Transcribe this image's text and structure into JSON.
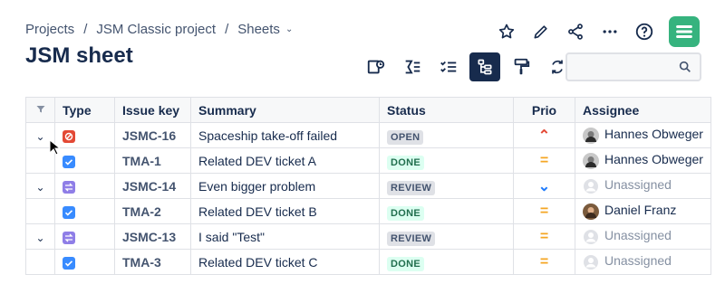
{
  "breadcrumb": {
    "items": [
      "Projects",
      "JSM Classic project",
      "Sheets"
    ],
    "sep": "/",
    "caret": "⌄"
  },
  "page": {
    "title": "JSM sheet"
  },
  "search": {
    "placeholder": ""
  },
  "colors": {
    "logo": "#36b37e",
    "active_tool": "#172b4d"
  },
  "table": {
    "headers": [
      "",
      "Type",
      "Issue key",
      "Summary",
      "Status",
      "Prio",
      "Assignee"
    ],
    "rows": [
      {
        "expand": "⌄",
        "type_icon": "incident-icon",
        "type_color": "#e34935",
        "key": "JSMC-16",
        "summary": "Spaceship take-off failed",
        "status": "OPEN",
        "status_style": "grey",
        "prio": "high",
        "prio_glyph": "⌃",
        "prio_color": "#e34935",
        "assignee": "Hannes Obweger",
        "avatar": "person"
      },
      {
        "expand": "",
        "type_icon": "task-icon",
        "type_color": "#388bff",
        "key": "TMA-1",
        "summary": "Related DEV ticket A",
        "status": "DONE",
        "status_style": "green",
        "prio": "medium",
        "prio_glyph": "=",
        "prio_color": "#f5a623",
        "assignee": "Hannes Obweger",
        "avatar": "person"
      },
      {
        "expand": "⌄",
        "type_icon": "change-icon",
        "type_color": "#8f7ee7",
        "key": "JSMC-14",
        "summary": "Even bigger problem",
        "status": "REVIEW",
        "status_style": "grey",
        "prio": "low",
        "prio_glyph": "⌄",
        "prio_color": "#1d7afc",
        "assignee": "Unassigned",
        "avatar": "none"
      },
      {
        "expand": "",
        "type_icon": "task-icon",
        "type_color": "#388bff",
        "key": "TMA-2",
        "summary": "Related DEV ticket B",
        "status": "DONE",
        "status_style": "green",
        "prio": "medium",
        "prio_glyph": "=",
        "prio_color": "#f5a623",
        "assignee": "Daniel Franz",
        "avatar": "person2"
      },
      {
        "expand": "⌄",
        "type_icon": "change-icon",
        "type_color": "#8f7ee7",
        "key": "JSMC-13",
        "summary": "I said \"Test\"",
        "status": "REVIEW",
        "status_style": "grey",
        "prio": "medium",
        "prio_glyph": "=",
        "prio_color": "#f5a623",
        "assignee": "Unassigned",
        "avatar": "none"
      },
      {
        "expand": "",
        "type_icon": "task-icon",
        "type_color": "#388bff",
        "key": "TMA-3",
        "summary": "Related DEV ticket C",
        "status": "DONE",
        "status_style": "green",
        "prio": "medium",
        "prio_glyph": "=",
        "prio_color": "#f5a623",
        "assignee": "Unassigned",
        "avatar": "none"
      }
    ]
  }
}
